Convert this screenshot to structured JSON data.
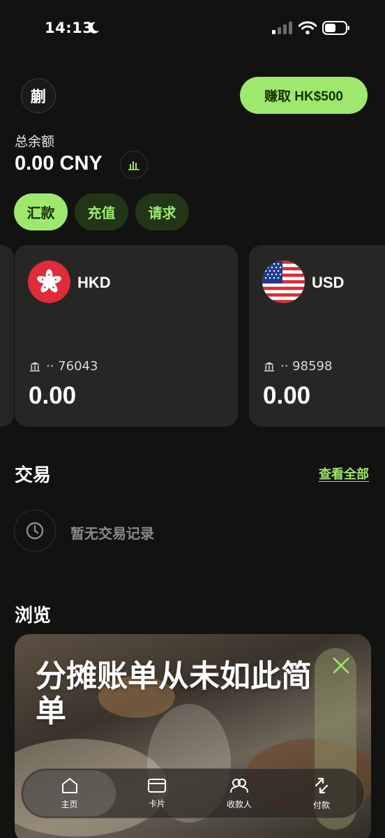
{
  "status_bar": {
    "time": "14:13",
    "icons": [
      "moon-icon",
      "signal-icon",
      "wifi-icon",
      "battery-icon"
    ]
  },
  "header": {
    "avatar_initial": "蒯",
    "earn_label": "赚取 HK$500"
  },
  "balance": {
    "label": "总余额",
    "amount": "0.00 CNY",
    "insights_icon": "bar-chart-icon"
  },
  "actions": [
    {
      "label": "汇款"
    },
    {
      "label": "充值"
    },
    {
      "label": "请求"
    }
  ],
  "accounts": [
    {
      "currency": "HKD",
      "account_mask": "·· 76043",
      "amount": "0.00",
      "flag": "hong-kong-flag"
    },
    {
      "currency": "USD",
      "account_mask": "·· 98598",
      "amount": "0.00",
      "flag": "us-flag"
    }
  ],
  "transactions": {
    "title": "交易",
    "see_all": "查看全部",
    "empty_text": "暂无交易记录"
  },
  "browse": {
    "title": "浏览",
    "promo_title": "分摊账单从未如此简单"
  },
  "nav": [
    {
      "label": "主页",
      "icon": "home-icon"
    },
    {
      "label": "卡片",
      "icon": "card-icon"
    },
    {
      "label": "收款人",
      "icon": "recipients-icon"
    },
    {
      "label": "付款",
      "icon": "payments-icon"
    }
  ],
  "colors": {
    "accent": "#9fe870",
    "accent_dark": "#163300",
    "background": "#121311",
    "card": "#262725"
  }
}
